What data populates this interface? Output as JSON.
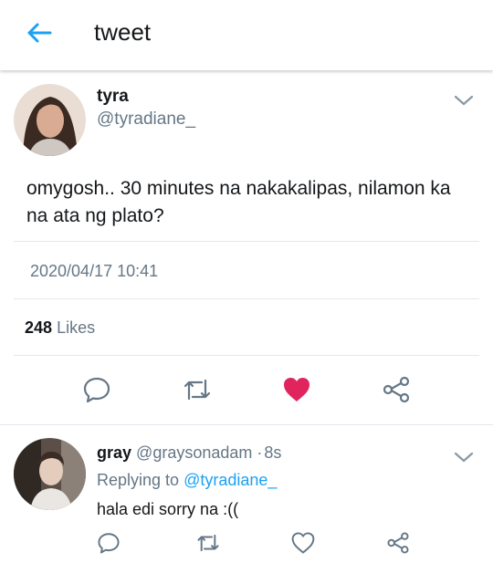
{
  "header": {
    "title": "tweet"
  },
  "tweet": {
    "author_name": "tyra",
    "author_handle": "@tyradiane_",
    "text": "omygosh.. 30 minutes na nakakalipas, nilamon ka na ata ng plato?",
    "timestamp": "2020/04/17 10:41",
    "likes_count": "248",
    "likes_label": "Likes",
    "liked": true,
    "like_color": "#e0245e"
  },
  "reply": {
    "author_name": "gray",
    "author_handle": "@graysonadam",
    "separator": "·",
    "age": "8s",
    "reply_to_label": "Replying to",
    "reply_to_handle": "@tyradiane_",
    "text": "hala edi sorry na :(("
  },
  "colors": {
    "accent": "#1da1f2",
    "secondary_text": "#657786",
    "icon_gray": "#657786"
  },
  "icons": [
    "back-arrow-icon",
    "chevron-down-icon",
    "reply-icon",
    "retweet-icon",
    "heart-icon",
    "share-icon"
  ]
}
